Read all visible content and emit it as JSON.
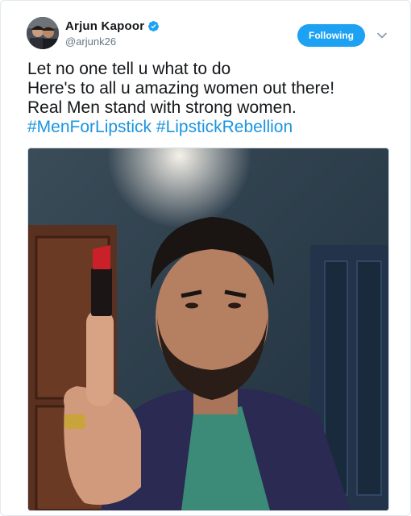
{
  "author": {
    "display_name": "Arjun Kapoor",
    "handle": "@arjunk26",
    "verified": true,
    "avatar_icon": "profile-avatar"
  },
  "follow_button": {
    "label": "Following"
  },
  "menu_icon": "chevron-down-icon",
  "tweet": {
    "lines": [
      "Let no one tell u what to do",
      "Here's to all u amazing women out there!",
      "Real Men stand with strong women."
    ],
    "hashtags": [
      "#MenForLipstick",
      "#LipstickRebellion"
    ]
  },
  "colors": {
    "brand_blue": "#1da1f2",
    "hashtag_blue": "#1b95e0",
    "text": "#14171a",
    "muted": "#657786"
  }
}
